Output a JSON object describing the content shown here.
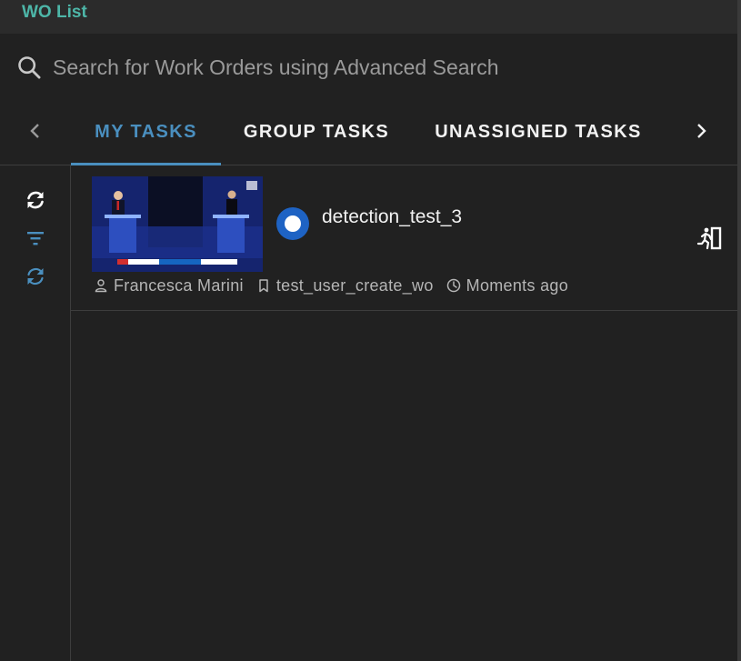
{
  "window": {
    "title": "WO List"
  },
  "search": {
    "placeholder": "Search for Work Orders using Advanced Search",
    "value": ""
  },
  "tabs": [
    {
      "label": "MY TASKS",
      "active": true
    },
    {
      "label": "GROUP TASKS",
      "active": false
    },
    {
      "label": "UNASSIGNED TASKS",
      "active": false
    }
  ],
  "rail": {
    "icons": [
      "refresh-icon",
      "filter-icon",
      "sync-icon"
    ]
  },
  "work_orders": [
    {
      "title": "detection_test_3",
      "assignee": "Francesca Marini",
      "workflow": "test_user_create_wo",
      "time": "Moments ago",
      "status_color": "#1e63c4",
      "thumbnail": "video-thumbnail"
    }
  ],
  "colors": {
    "accent": "#4a8fbf",
    "title": "#4db6a8",
    "background": "#212121"
  }
}
